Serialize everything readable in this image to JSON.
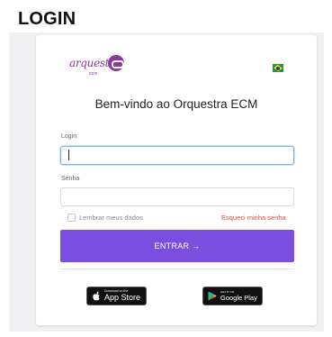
{
  "page": {
    "heading": "LOGIN"
  },
  "logo": {
    "word": "arquestro",
    "sub": "ecm"
  },
  "welcome": "Bem-vindo ao Orquestra ECM",
  "form": {
    "login_label": "Login",
    "login_value": "",
    "senha_label": "Senha",
    "senha_value": "",
    "remember_label": "Lembrar meus dados",
    "remember_checked": false,
    "forgot_label": "Esqueci minha senha",
    "submit_label": "ENTRAR →"
  },
  "stores": {
    "appstore_small": "Download on the",
    "appstore_big": "App Store",
    "googleplay_small": "GET IT ON",
    "googleplay_big": "Google Play"
  },
  "colors": {
    "accent": "#7a4fe0",
    "brand": "#8c3a98",
    "link_red": "#e04848"
  },
  "icons": {
    "brand_badge": "orquestra-badge-icon",
    "language_flag": "brazil-flag-icon",
    "apple": "apple-icon",
    "google_play": "google-play-icon"
  }
}
